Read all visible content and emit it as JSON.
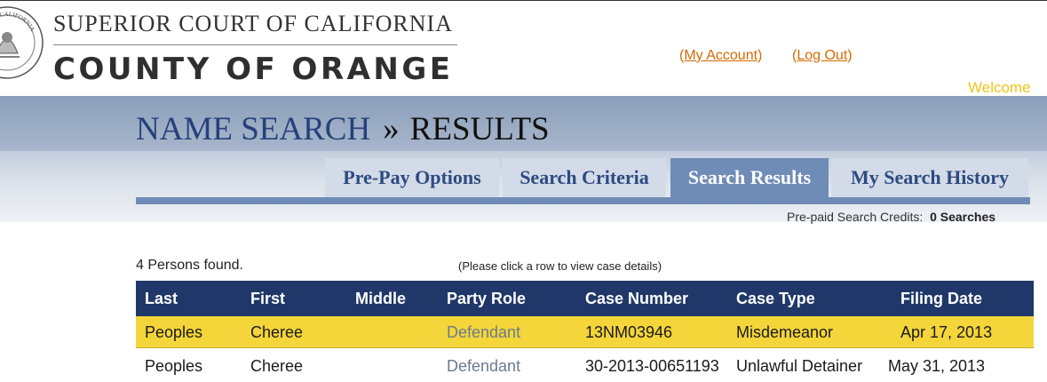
{
  "header": {
    "court_name": "SUPERIOR COURT OF CALIFORNIA",
    "county_name": "COUNTY OF ORANGE",
    "seal_text": "OF CALIFORNIA",
    "my_account": "My Account",
    "log_out": "Log Out",
    "welcome": "Welcome"
  },
  "title": {
    "section": "NAME SEARCH",
    "separator": "»",
    "page": "RESULTS"
  },
  "tabs": [
    {
      "label": "Pre-Pay Options",
      "active": false
    },
    {
      "label": "Search Criteria",
      "active": false
    },
    {
      "label": "Search Results",
      "active": true
    },
    {
      "label": "My Search History",
      "active": false
    }
  ],
  "credits": {
    "label": "Pre-paid Search Credits:",
    "value": "0 Searches"
  },
  "results": {
    "count_text": "4 Persons found.",
    "hint": "(Please click a row to view case details)",
    "columns": [
      "Last",
      "First",
      "Middle",
      "Party Role",
      "Case Number",
      "Case Type",
      "Filing Date"
    ],
    "rows": [
      {
        "last": "Peoples",
        "first": "Cheree",
        "middle": "",
        "role": "Defendant",
        "case_number": "13NM03946",
        "case_type": "Misdemeanor",
        "filing_date": "Apr 17, 2013"
      },
      {
        "last": "Peoples",
        "first": "Cheree",
        "middle": "",
        "role": "Defendant",
        "case_number": "30-2013-00651193",
        "case_type": "Unlawful Detainer",
        "filing_date": "May 31, 2013"
      }
    ]
  },
  "colors": {
    "header_navy": "#1f3869",
    "tab_active": "#6f8cb6",
    "row_highlight": "#f4d53a",
    "link_orange": "#d46a00",
    "welcome_yellow": "#f2c417"
  }
}
